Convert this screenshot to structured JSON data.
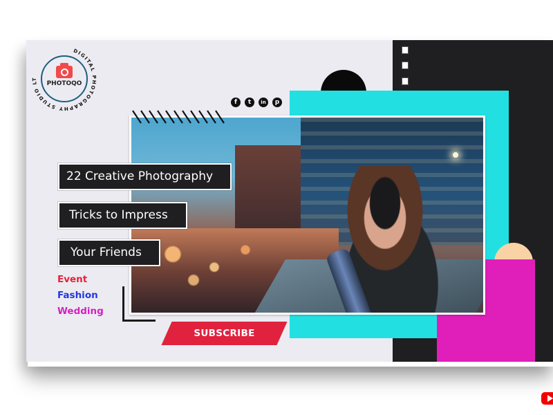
{
  "logo": {
    "name": "PHOTOQO",
    "arc_text": "DIGITAL PHOTOGRAPHY STUDIO LTD.",
    "icon": "camera-icon"
  },
  "social": [
    {
      "name": "facebook",
      "glyph": "f",
      "icon": "facebook-icon"
    },
    {
      "name": "twitter",
      "glyph": "t",
      "icon": "twitter-icon"
    },
    {
      "name": "linkedin",
      "glyph": "in",
      "icon": "linkedin-icon"
    },
    {
      "name": "pinterest",
      "glyph": "p",
      "icon": "pinterest-icon"
    }
  ],
  "title": {
    "line1": "22 Creative Photography",
    "line2": "Tricks to Impress",
    "line3": "Your Friends"
  },
  "categories": [
    {
      "label": "Event",
      "color": "#e4223c"
    },
    {
      "label": "Fashion",
      "color": "#2436e0"
    },
    {
      "label": "Wedding",
      "color": "#d61fc2"
    }
  ],
  "cta": {
    "label": "SUBSCRIBE",
    "color": "#e0223f"
  },
  "photo": {
    "description": "woman photographing with camera on city bridge at dusk"
  },
  "colors": {
    "background": "#ecebf1",
    "dark": "#1f1f21",
    "cyan": "#22e0e2",
    "magenta": "#e01fba",
    "peach": "#f9d3a6",
    "youtube": "#f50000"
  },
  "badge": {
    "icon": "youtube-icon"
  }
}
